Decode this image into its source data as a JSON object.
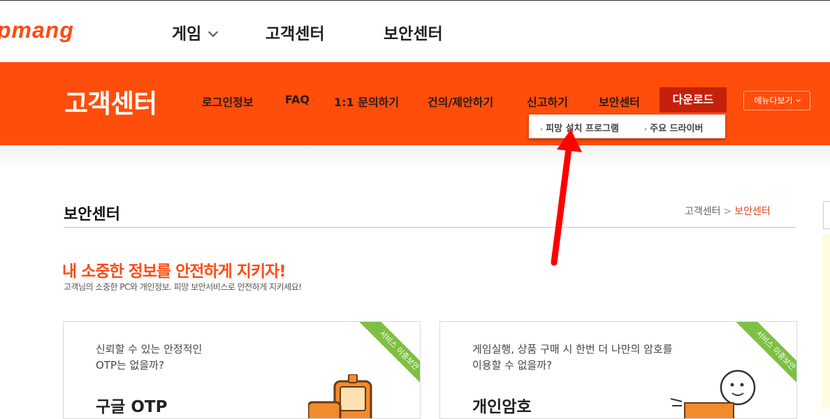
{
  "header": {
    "logo_text": "pmang",
    "nav": [
      {
        "label": "게임"
      },
      {
        "label": "고객센터"
      },
      {
        "label": "보안센터"
      }
    ]
  },
  "band": {
    "title": "고객센터",
    "nav": [
      {
        "label": "로그인정보"
      },
      {
        "label": "FAQ"
      },
      {
        "label": "1:1 문의하기"
      },
      {
        "label": "건의/제안하기"
      },
      {
        "label": "신고하기"
      },
      {
        "label": "보안센터"
      }
    ],
    "active_label": "다운로드",
    "menu_all_label": "메뉴다보기",
    "dropdown": [
      {
        "label": "피망 설치 프로그램"
      },
      {
        "label": "주요 드라이버"
      }
    ]
  },
  "page": {
    "title": "보안센터",
    "breadcrumb": {
      "root": "고객센터",
      "separator": ">",
      "current": "보안센터"
    },
    "headline": "내 소중한 정보를 안전하게 지키자!",
    "subline": "고객님의 소중한 PC와 개인정보. 피망 보안서비스로 안전하게 지키세요!"
  },
  "cards": [
    {
      "question_line1": "신뢰할 수 있는 안정적인",
      "question_line2": "OTP는 없을까?",
      "title": "구글 OTP",
      "ribbon": "서비스 이중보안"
    },
    {
      "question_line1": "게임실행, 상품 구매 시 한번 더 나만의 암호를",
      "question_line2": "이용할 수 없을까?",
      "title": "개인암호",
      "ribbon": "서비스 이중보안"
    }
  ],
  "colors": {
    "brand": "#ff4d0c",
    "active_tab": "#c4210b",
    "ribbon": "#7dc043",
    "annotation_arrow": "#ff0000"
  }
}
